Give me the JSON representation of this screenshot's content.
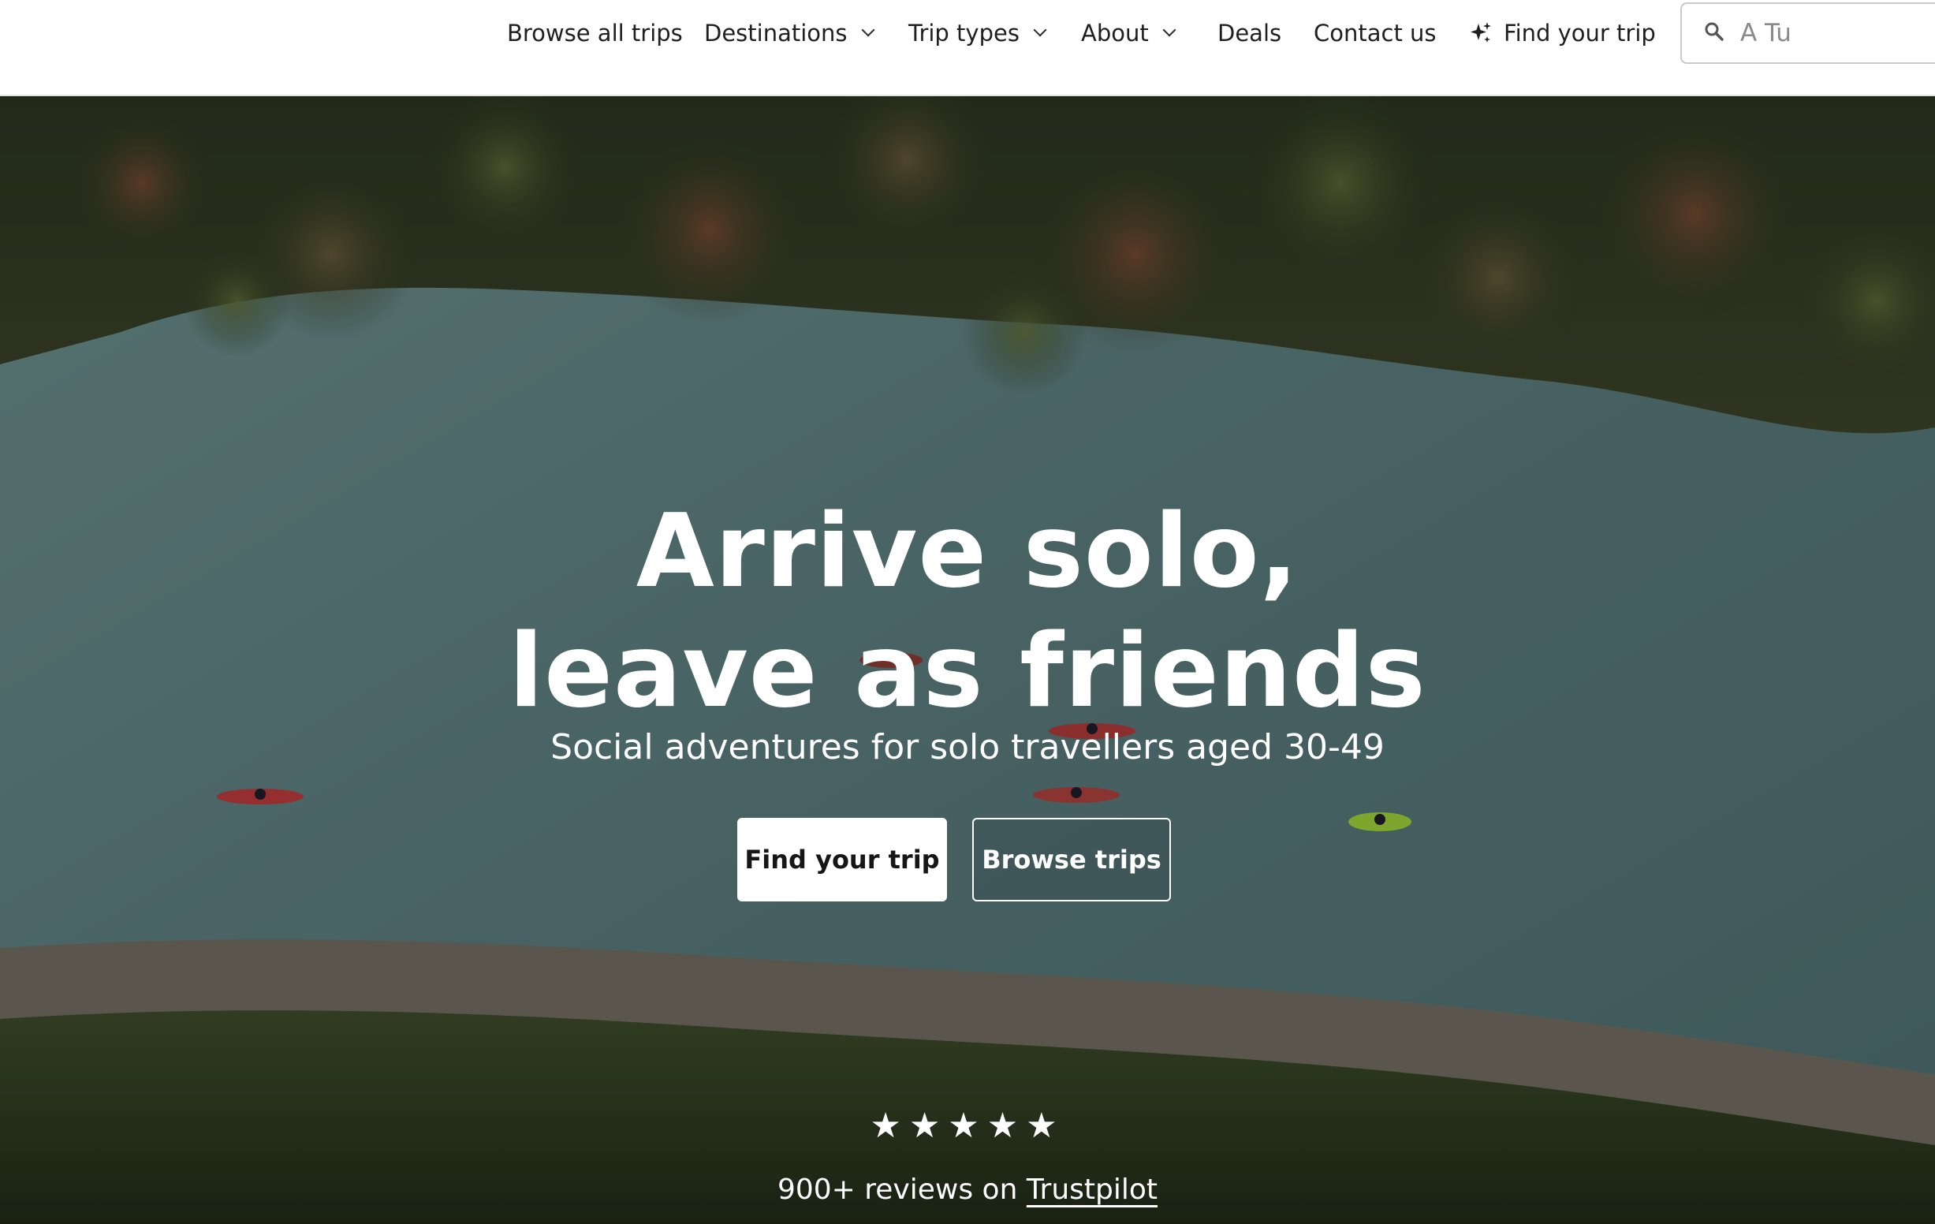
{
  "nav": {
    "items": [
      {
        "label": "Browse all trips",
        "has_dropdown": false
      },
      {
        "label": "Destinations",
        "has_dropdown": true
      },
      {
        "label": "Trip types",
        "has_dropdown": true
      },
      {
        "label": "About",
        "has_dropdown": true
      },
      {
        "label": "Deals",
        "has_dropdown": false
      },
      {
        "label": "Contact us",
        "has_dropdown": false
      }
    ],
    "find_trip": {
      "label": "Find your trip",
      "icon": "sparkle-icon"
    },
    "search": {
      "placeholder": "A Tu",
      "icon": "search-icon"
    }
  },
  "hero": {
    "headline_line1": "Arrive solo,",
    "headline_line2": "leave as friends",
    "subheadline": "Social adventures for solo travellers aged 30-49",
    "primary_button": "Find your trip",
    "secondary_button": "Browse trips",
    "rating": {
      "stars": 5,
      "out_of": 5,
      "glyph": "★"
    },
    "reviews_text": "900+ reviews on",
    "reviews_link": "Trustpilot",
    "background": "aerial river photo with kayaks"
  },
  "colors": {
    "nav_bg": "#ffffff",
    "nav_text": "#1f1f1f",
    "river": "#5f8380",
    "forest": "#2e3a22",
    "button_primary_bg": "#ffffff",
    "button_text_light": "#ffffff"
  }
}
